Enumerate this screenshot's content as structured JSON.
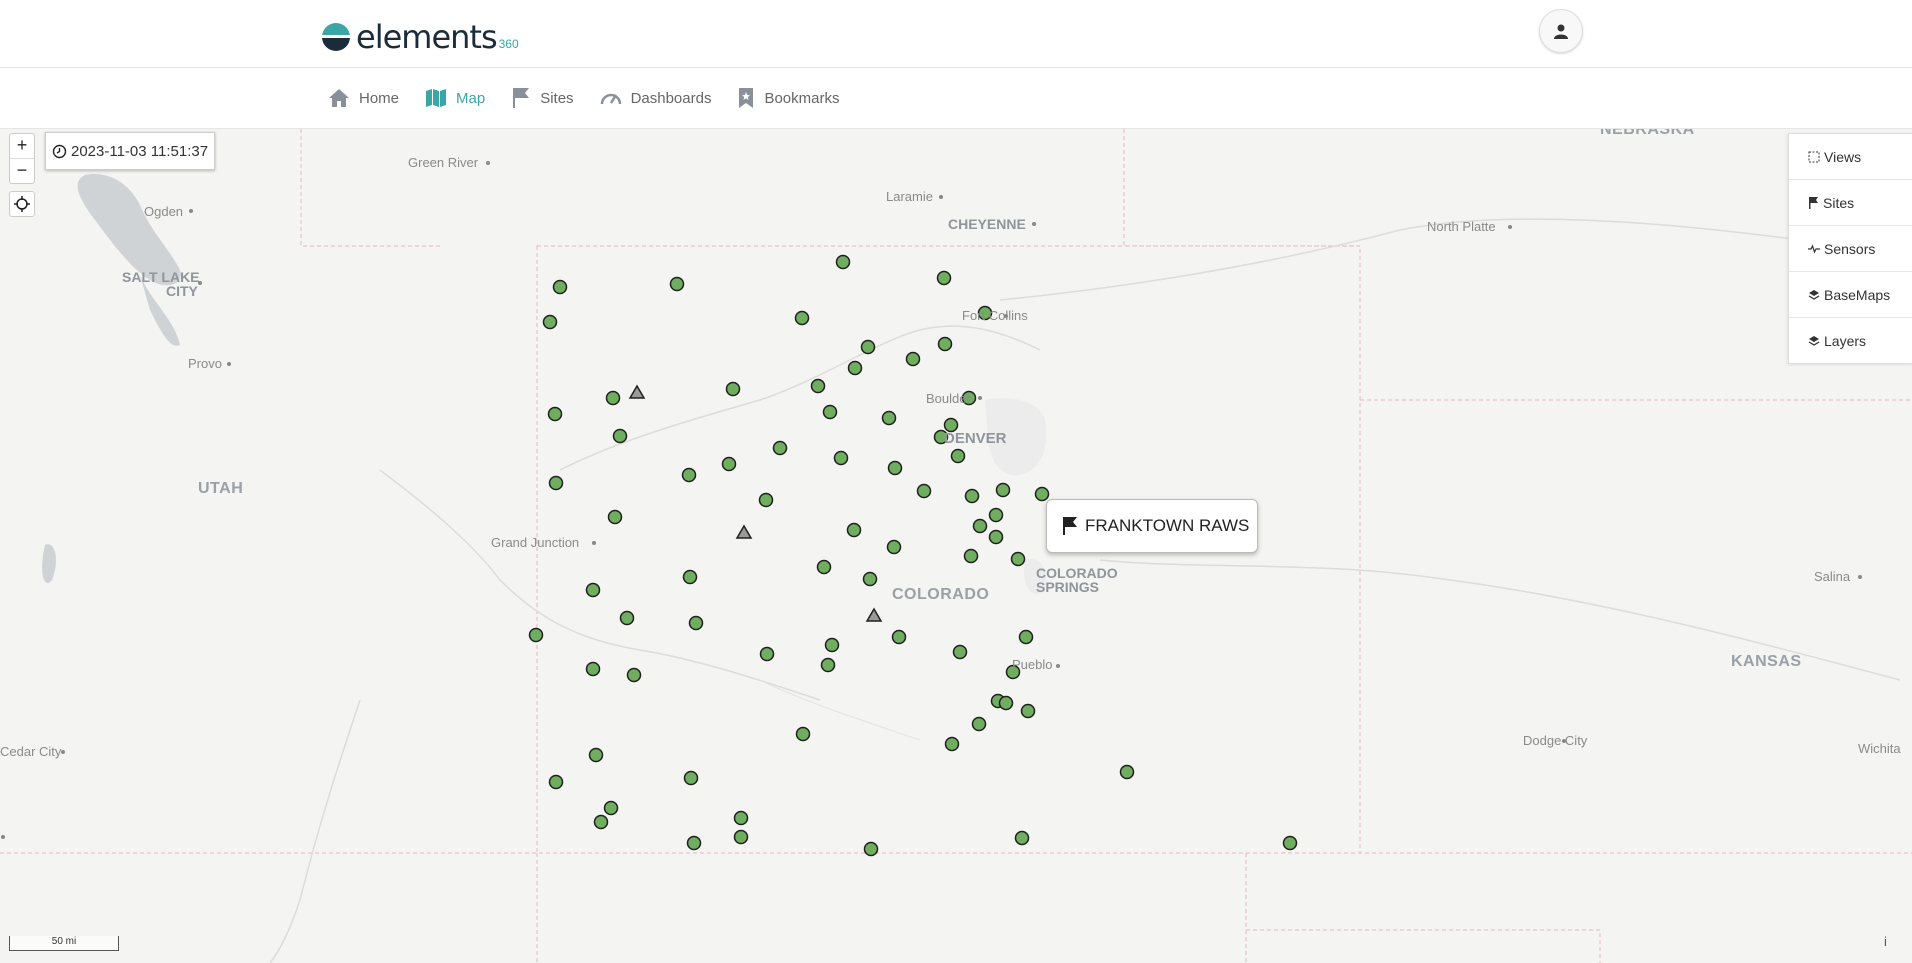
{
  "header": {
    "logo_text": "elements",
    "logo_sub": "360"
  },
  "nav": {
    "items": [
      {
        "label": "Home",
        "icon": "home-icon"
      },
      {
        "label": "Map",
        "icon": "map-icon",
        "active": true
      },
      {
        "label": "Sites",
        "icon": "flag-icon"
      },
      {
        "label": "Dashboards",
        "icon": "gauge-icon"
      },
      {
        "label": "Bookmarks",
        "icon": "bookmark-icon"
      }
    ]
  },
  "map": {
    "zoom_in": "+",
    "zoom_out": "−",
    "timestamp": "2023-11-03 11:51:37",
    "scale_label": "50 mi",
    "attribution": "i",
    "tooltip": "FRANKTOWN RAWS",
    "labels": {
      "nebraska": "NEBRASKA",
      "utah": "UTAH",
      "colorado": "COLORADO",
      "kansas": "KANSAS",
      "green_river": "Green River",
      "laramie": "Laramie",
      "cheyenne": "CHEYENNE",
      "north_platte": "North Platte",
      "ogden": "Ogden",
      "salt_lake_1": "SALT LAKE",
      "salt_lake_2": "CITY",
      "fort_collins": "Fort Collins",
      "provo": "Provo",
      "boulder": "Boulder",
      "denver": "DENVER",
      "grand_junction": "Grand Junction",
      "colorado_springs_1": "COLORADO",
      "colorado_springs_2": "SPRINGS",
      "salina": "Salina",
      "pueblo": "Pueblo",
      "cedar_city": "Cedar City",
      "dodge_city": "Dodge City",
      "wichita": "Wichita"
    },
    "marker_color": "#6fae5f",
    "triangle_color": "#9a9a9a"
  },
  "side_panel": {
    "items": [
      {
        "label": "Views",
        "icon": "dashed-square-icon"
      },
      {
        "label": "Sites",
        "icon": "flag-icon"
      },
      {
        "label": "Sensors",
        "icon": "pulse-icon"
      },
      {
        "label": "BaseMaps",
        "icon": "layers-icon"
      },
      {
        "label": "Layers",
        "icon": "layers-icon"
      }
    ]
  }
}
